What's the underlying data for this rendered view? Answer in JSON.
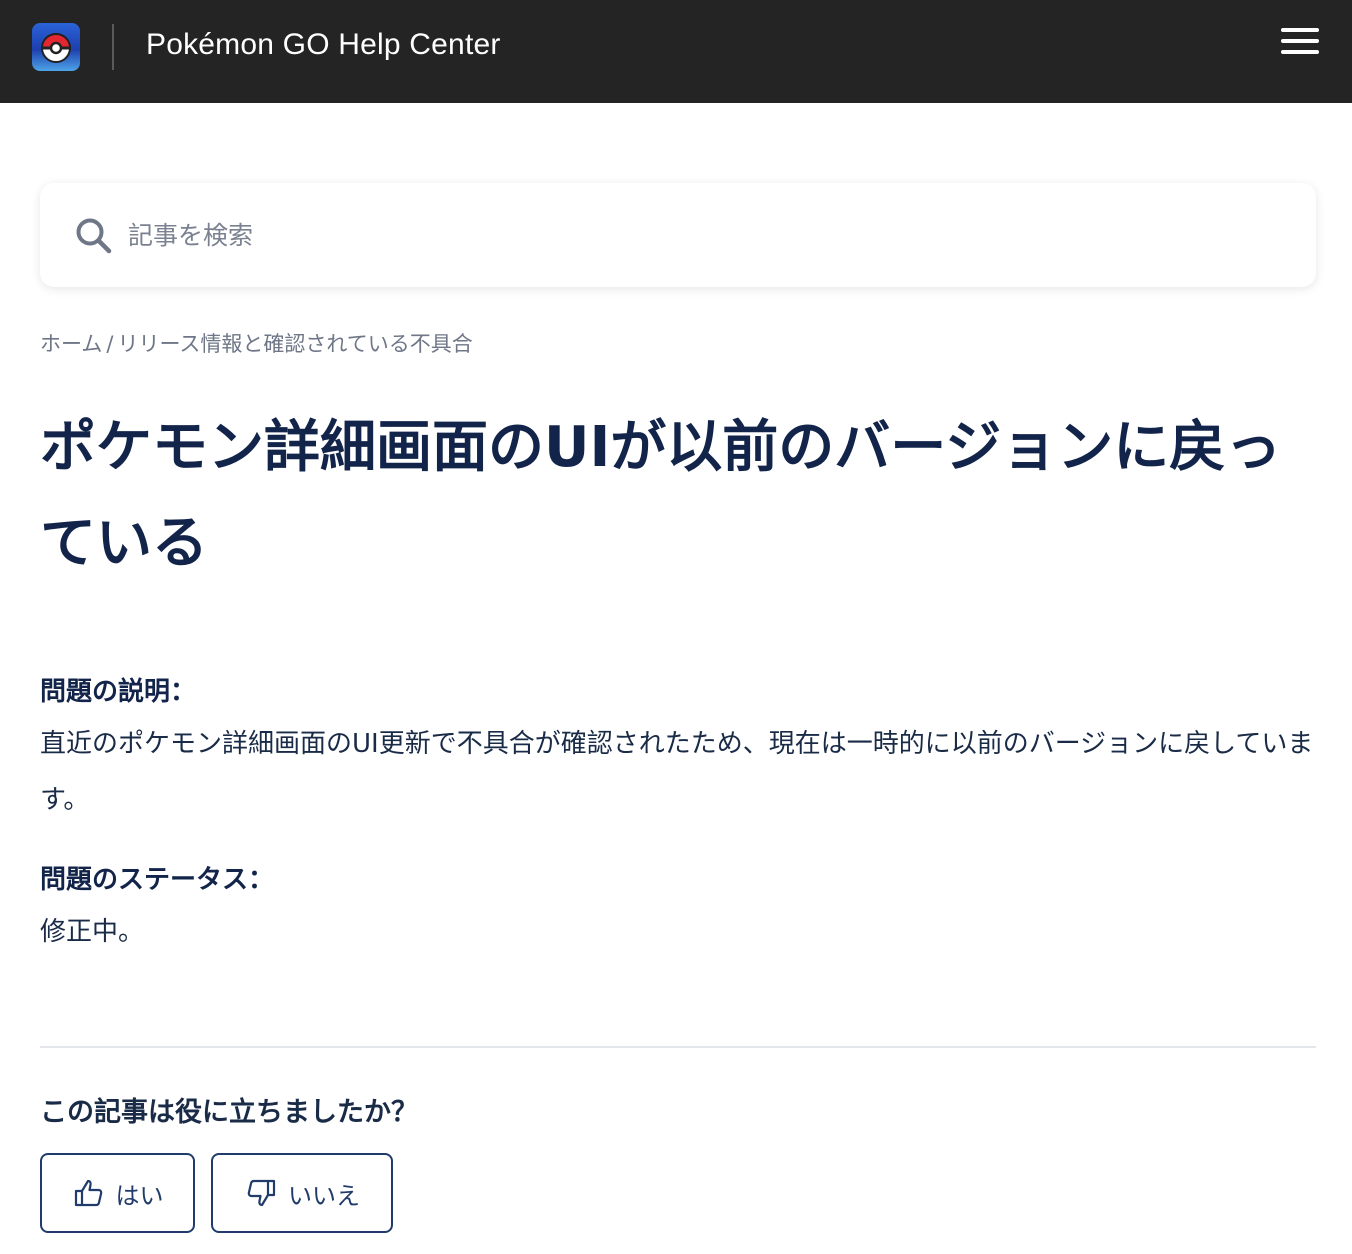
{
  "header": {
    "site_title": "Pokémon GO Help Center",
    "logo_icon": "pokeball-logo-icon",
    "menu_icon": "hamburger-menu-icon",
    "background_color": "#242424"
  },
  "search": {
    "placeholder": "記事を検索",
    "value": "",
    "icon": "search-icon"
  },
  "breadcrumb": {
    "home": "ホーム",
    "separator": "/",
    "category": "リリース情報と確認されている不具合"
  },
  "article": {
    "title": "ポケモン詳細画面のUIが以前のバージョンに戻っている",
    "description_label": "問題の説明：",
    "description_text": "直近のポケモン詳細画面のUI更新で不具合が確認されたため、現在は一時的に以前のバージョンに戻しています。",
    "status_label": "問題のステータス：",
    "status_text": "修正中。"
  },
  "feedback": {
    "question": "この記事は役に立ちましたか？",
    "yes_label": "はい",
    "no_label": "いいえ",
    "yes_icon": "thumbs-up-icon",
    "no_icon": "thumbs-down-icon",
    "accent_color": "#213c6b"
  }
}
